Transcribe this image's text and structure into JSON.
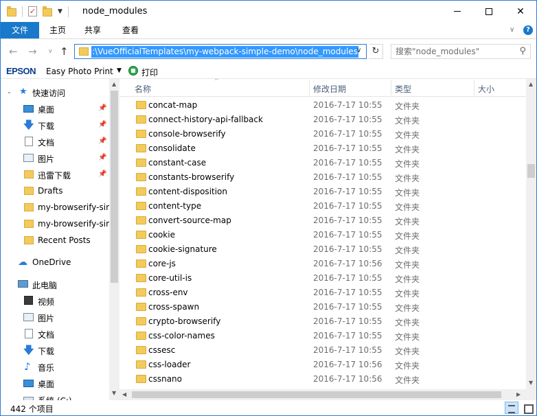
{
  "window": {
    "title": "node_modules"
  },
  "ribbon": {
    "tabs": [
      {
        "label": "文件"
      },
      {
        "label": "主页"
      },
      {
        "label": "共享"
      },
      {
        "label": "查看"
      }
    ]
  },
  "address": {
    "path": ":\\VueOfficialTemplates\\my-webpack-simple-demo\\node_modules"
  },
  "search": {
    "placeholder": "搜索\"node_modules\""
  },
  "toolbar": {
    "brand": "EPSON",
    "app": "Easy Photo Print",
    "print_label": "打印"
  },
  "nav": {
    "quick_access": "快速访问",
    "items": [
      {
        "label": "桌面",
        "icon": "desktop-icon"
      },
      {
        "label": "下载",
        "icon": "download-icon"
      },
      {
        "label": "文档",
        "icon": "documents-icon"
      },
      {
        "label": "图片",
        "icon": "pictures-icon"
      },
      {
        "label": "迅雷下载",
        "icon": "folder-icon"
      },
      {
        "label": "Drafts",
        "icon": "folder-icon"
      },
      {
        "label": "my-browserify-sir",
        "icon": "folder-icon"
      },
      {
        "label": "my-browserify-sir",
        "icon": "folder-icon"
      },
      {
        "label": "Recent Posts",
        "icon": "folder-icon"
      }
    ],
    "onedrive": "OneDrive",
    "this_pc": "此电脑",
    "pc_items": [
      {
        "label": "视频",
        "icon": "video-icon"
      },
      {
        "label": "图片",
        "icon": "pictures-icon"
      },
      {
        "label": "文档",
        "icon": "documents-icon"
      },
      {
        "label": "下载",
        "icon": "download-icon"
      },
      {
        "label": "音乐",
        "icon": "music-icon"
      },
      {
        "label": "桌面",
        "icon": "desktop-icon"
      },
      {
        "label": "系统 (C:)",
        "icon": "drive-icon"
      }
    ]
  },
  "columns": {
    "name": "名称",
    "date": "修改日期",
    "type": "类型",
    "size": "大小"
  },
  "files": [
    {
      "name": "concat-map",
      "date": "2016-7-17 10:55",
      "type": "文件夹"
    },
    {
      "name": "connect-history-api-fallback",
      "date": "2016-7-17 10:55",
      "type": "文件夹"
    },
    {
      "name": "console-browserify",
      "date": "2016-7-17 10:55",
      "type": "文件夹"
    },
    {
      "name": "consolidate",
      "date": "2016-7-17 10:55",
      "type": "文件夹"
    },
    {
      "name": "constant-case",
      "date": "2016-7-17 10:55",
      "type": "文件夹"
    },
    {
      "name": "constants-browserify",
      "date": "2016-7-17 10:55",
      "type": "文件夹"
    },
    {
      "name": "content-disposition",
      "date": "2016-7-17 10:55",
      "type": "文件夹"
    },
    {
      "name": "content-type",
      "date": "2016-7-17 10:55",
      "type": "文件夹"
    },
    {
      "name": "convert-source-map",
      "date": "2016-7-17 10:55",
      "type": "文件夹"
    },
    {
      "name": "cookie",
      "date": "2016-7-17 10:55",
      "type": "文件夹"
    },
    {
      "name": "cookie-signature",
      "date": "2016-7-17 10:55",
      "type": "文件夹"
    },
    {
      "name": "core-js",
      "date": "2016-7-17 10:56",
      "type": "文件夹"
    },
    {
      "name": "core-util-is",
      "date": "2016-7-17 10:55",
      "type": "文件夹"
    },
    {
      "name": "cross-env",
      "date": "2016-7-17 10:55",
      "type": "文件夹"
    },
    {
      "name": "cross-spawn",
      "date": "2016-7-17 10:55",
      "type": "文件夹"
    },
    {
      "name": "crypto-browserify",
      "date": "2016-7-17 10:55",
      "type": "文件夹"
    },
    {
      "name": "css-color-names",
      "date": "2016-7-17 10:55",
      "type": "文件夹"
    },
    {
      "name": "cssesc",
      "date": "2016-7-17 10:55",
      "type": "文件夹"
    },
    {
      "name": "css-loader",
      "date": "2016-7-17 10:56",
      "type": "文件夹"
    },
    {
      "name": "cssnano",
      "date": "2016-7-17 10:56",
      "type": "文件夹"
    }
  ],
  "status": {
    "count": "442 个项目"
  },
  "colors": {
    "accent": "#1979ca",
    "selection": "#3399ff",
    "folder": "#f2cb5c"
  }
}
